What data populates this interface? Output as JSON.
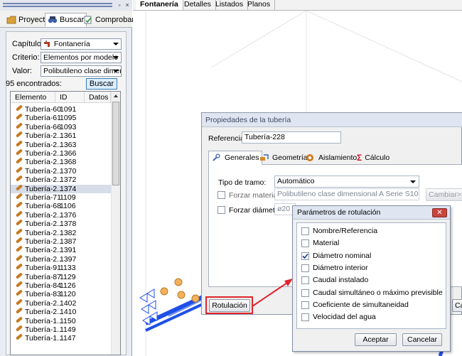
{
  "left_panel": {
    "tabs": [
      {
        "label": "Proyecto"
      },
      {
        "label": "Buscar"
      },
      {
        "label": "Comprobar"
      }
    ],
    "filters": {
      "capitulo_label": "Capítulo:",
      "capitulo_value": "Fontanería",
      "criterio_label": "Criterio:",
      "criterio_value": "Elementos por modelo",
      "valor_label": "Valor:",
      "valor_value": "Polibutileno clase dimensior"
    },
    "found_text": "95 encontrados:",
    "search_button": "Buscar",
    "list": {
      "headers": [
        "Elemento",
        "ID",
        "Datos"
      ],
      "rows": [
        {
          "name": "Tubería-60",
          "id": "1091"
        },
        {
          "name": "Tubería-61",
          "id": "1095"
        },
        {
          "name": "Tubería-66",
          "id": "1093"
        },
        {
          "name": "Tubería-2...",
          "id": "1361"
        },
        {
          "name": "Tubería-2...",
          "id": "1363"
        },
        {
          "name": "Tubería-2...",
          "id": "1366"
        },
        {
          "name": "Tubería-2...",
          "id": "1368"
        },
        {
          "name": "Tubería-2...",
          "id": "1370"
        },
        {
          "name": "Tubería-2...",
          "id": "1372"
        },
        {
          "name": "Tubería-2...",
          "id": "1374"
        },
        {
          "name": "Tubería-71",
          "id": "1109"
        },
        {
          "name": "Tubería-68",
          "id": "1106"
        },
        {
          "name": "Tubería-2...",
          "id": "1376"
        },
        {
          "name": "Tubería-2...",
          "id": "1378"
        },
        {
          "name": "Tubería-2...",
          "id": "1382"
        },
        {
          "name": "Tubería-2...",
          "id": "1387"
        },
        {
          "name": "Tubería-2...",
          "id": "1391"
        },
        {
          "name": "Tubería-2...",
          "id": "1397"
        },
        {
          "name": "Tubería-91",
          "id": "1133"
        },
        {
          "name": "Tubería-87",
          "id": "1129"
        },
        {
          "name": "Tubería-84",
          "id": "1126"
        },
        {
          "name": "Tubería-83",
          "id": "1120"
        },
        {
          "name": "Tubería-2...",
          "id": "1402"
        },
        {
          "name": "Tubería-2...",
          "id": "1410"
        },
        {
          "name": "Tubería-1...",
          "id": "1150"
        },
        {
          "name": "Tubería-1...",
          "id": "1149"
        },
        {
          "name": "Tubería-1...",
          "id": "1147"
        }
      ]
    }
  },
  "top_tabs": [
    {
      "label": "Fontanería"
    },
    {
      "label": "Detalles"
    },
    {
      "label": "Listados"
    },
    {
      "label": "Planos"
    }
  ],
  "properties_dialog": {
    "title": "Propiedades de la tubería",
    "referencia_label": "Referencia:",
    "referencia_value": "Tubería-228",
    "tabs": [
      {
        "label": "Generales"
      },
      {
        "label": "Geometría"
      },
      {
        "label": "Aislamiento"
      },
      {
        "label": "Cálculo"
      }
    ],
    "tipo_tramo_label": "Tipo de tramo:",
    "tipo_tramo_value": "Automático",
    "forzar_material_label": "Forzar material:",
    "forzar_material_value": "Polibutileno clase dimensional A Serie S10",
    "cambiar_button": "Cambiar>>",
    "forzar_diametro_label": "Forzar diámetro:",
    "forzar_diametro_value": "ø20",
    "rotulacion_button": "Rotulación",
    "cancel_partial": "Ca"
  },
  "rotulacion_dialog": {
    "title": "Parámetros de rotulación",
    "close_glyph": "✕",
    "options": [
      {
        "label": "Nombre/Referencia",
        "checked": false
      },
      {
        "label": "Material",
        "checked": false
      },
      {
        "label": "Diámetro nominal",
        "checked": true
      },
      {
        "label": "Diámetro interior",
        "checked": false
      },
      {
        "label": "Caudal instalado",
        "checked": false
      },
      {
        "label": "Caudal simultáneo o máximo previsible",
        "checked": false
      },
      {
        "label": "Coeficiente de simultaneidad",
        "checked": false
      },
      {
        "label": "Velocidad del agua",
        "checked": false
      }
    ],
    "accept_button": "Aceptar",
    "cancel_button": "Cancelar"
  },
  "colors": {
    "pipe_blue": "#1f4fe8",
    "highlight_red": "#e0242b",
    "pipe_list_icon": "#c77a22"
  }
}
